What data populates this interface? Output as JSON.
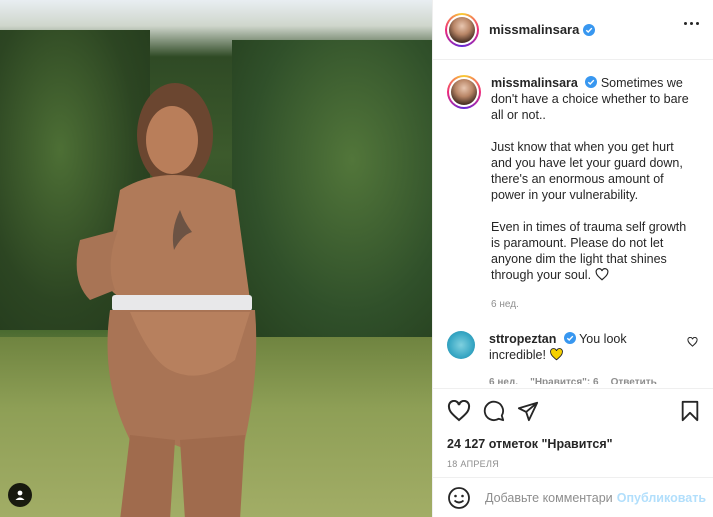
{
  "post": {
    "author": "missmalinsara",
    "caption_paragraphs": [
      "Sometimes we don't have a choice whether to bare all or not..",
      "Just know that when you get hurt and you have let your guard down, there's an enormous amount of power in your vulnerability.",
      "Even in times of trauma self growth is paramount. Please do not let anyone dim the light that shines through your soul."
    ],
    "caption_age": "6 нед.",
    "likes_text": "24 127 отметок \"Нравится\"",
    "date": "18 АПРЕЛЯ"
  },
  "comments": [
    {
      "username": "sttropeztan",
      "text": "You look incredible!",
      "age": "6 нед.",
      "likes": "\"Нравится\": 6",
      "reply": "Ответить"
    }
  ],
  "add_comment": {
    "placeholder": "Добавьте комментарий...",
    "post_label": "Опубликовать"
  },
  "icons": {
    "verified": "verified-badge-icon",
    "more": "more-options-icon",
    "heart": "heart-icon",
    "comment": "comment-icon",
    "share": "share-icon",
    "bookmark": "bookmark-icon",
    "emoji": "emoji-icon",
    "yellow_heart": "yellow-heart-icon",
    "user_tag": "user-tag-icon"
  },
  "colors": {
    "verified": "#3897f0",
    "text": "#262626",
    "muted": "#8e8e8e",
    "post_button_disabled": "#b2dffc",
    "yellow_heart": "#f5d000"
  }
}
